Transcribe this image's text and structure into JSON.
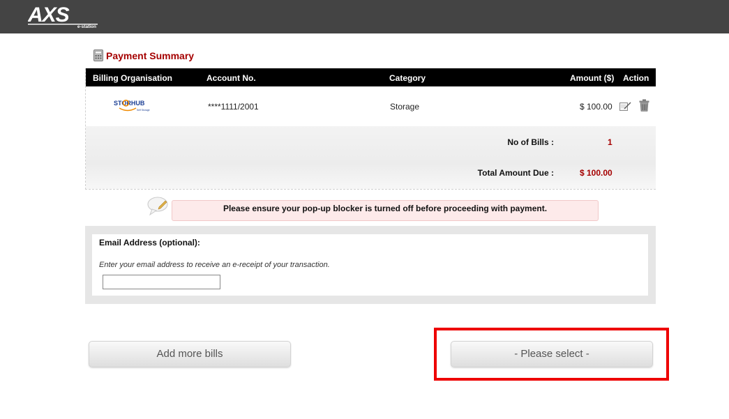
{
  "header": {
    "logo_text": "AXS",
    "logo_sub": "e-station"
  },
  "summary_section": {
    "title": "Payment Summary",
    "icon": "calculator-icon"
  },
  "bills_table": {
    "columns": {
      "org": "Billing Organisation",
      "account": "Account No.",
      "category": "Category",
      "amount": "Amount ($)",
      "action": "Action"
    },
    "rows": [
      {
        "org_logo_text": "STORHUB",
        "org_logo_sub": "Self Storage",
        "account": "****1111/2001",
        "category": "Storage",
        "amount": "$ 100.00",
        "edit_icon": "edit-icon",
        "delete_icon": "trash-icon"
      }
    ],
    "no_of_bills_label": "No of Bills :",
    "no_of_bills_value": "1",
    "total_label": "Total Amount Due :",
    "total_value": "$ 100.00"
  },
  "notice": {
    "icon": "speech-bubble-icon",
    "text": "Please ensure your pop-up blocker is turned off before proceeding with payment."
  },
  "email": {
    "label": "Email Address (optional):",
    "hint": "Enter your email address to receive an e-receipt of your transaction.",
    "value": ""
  },
  "buttons": {
    "add_more": "Add more bills",
    "select": "- Please select -"
  },
  "colors": {
    "header_bg": "#444444",
    "accent_red": "#a50000",
    "highlight": "#ee0000",
    "notice_bg": "#fdeaea"
  }
}
